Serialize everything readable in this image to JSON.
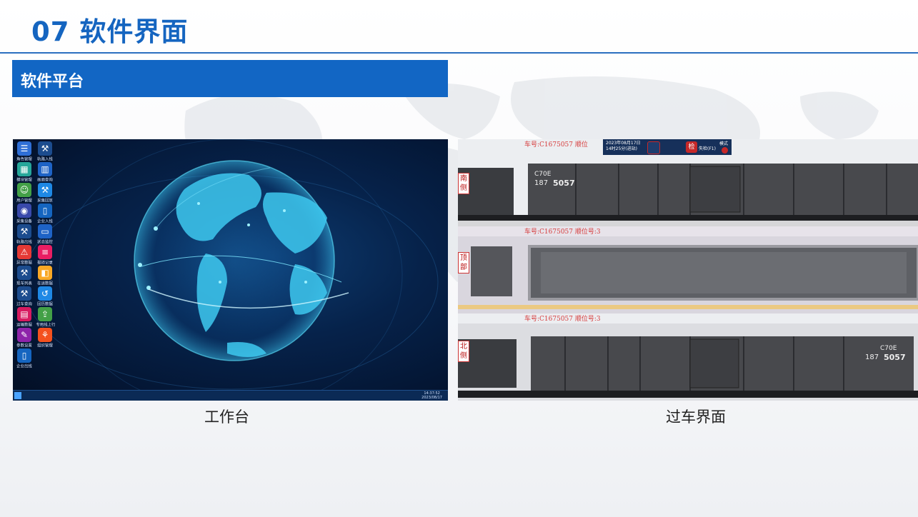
{
  "slide": {
    "title": "07 软件界面",
    "section_heading": "软件平台"
  },
  "workbench": {
    "caption": "工作台",
    "apps": [
      {
        "label": "角色管理",
        "icon": "list-icon",
        "color": "#2f6fd6"
      },
      {
        "label": "轨路入线",
        "icon": "train-icon",
        "color": "#1c4c8e"
      },
      {
        "label": "模块管理",
        "icon": "modules-icon",
        "color": "#26a69a"
      },
      {
        "label": "画面查询",
        "icon": "bar-chart-icon",
        "color": "#1e63c6"
      },
      {
        "label": "用户管理",
        "icon": "user-icon",
        "color": "#43a047"
      },
      {
        "label": "采集回放",
        "icon": "train-icon",
        "color": "#1e88e5"
      },
      {
        "label": "采集设备",
        "icon": "camera-icon",
        "color": "#3949ab"
      },
      {
        "label": "企业入线",
        "icon": "door-icon",
        "color": "#1565c0"
      },
      {
        "label": "轨路出线",
        "icon": "train-icon",
        "color": "#1c4c8e"
      },
      {
        "label": "状态监控",
        "icon": "monitor-icon",
        "color": "#1e63c6"
      },
      {
        "label": "异常数据",
        "icon": "warning-icon",
        "color": "#e53935"
      },
      {
        "label": "报损记录",
        "icon": "record-icon",
        "color": "#e91e63"
      },
      {
        "label": "现车列表",
        "icon": "train-icon",
        "color": "#1c4c8e"
      },
      {
        "label": "在途数据",
        "icon": "data-icon",
        "color": "#f9a825"
      },
      {
        "label": "过车查询",
        "icon": "train-icon",
        "color": "#1c4c8e"
      },
      {
        "label": "回历数据",
        "icon": "history-icon",
        "color": "#1e88e5"
      },
      {
        "label": "运输数据",
        "icon": "calendar-icon",
        "color": "#d81b60"
      },
      {
        "label": "专用线上行",
        "icon": "upload-icon",
        "color": "#43a047"
      },
      {
        "label": "参数设置",
        "icon": "edit-icon",
        "color": "#8e24aa"
      },
      {
        "label": "组织管理",
        "icon": "org-icon",
        "color": "#f4511e"
      },
      {
        "label": "企业出线",
        "icon": "door-icon",
        "color": "#1565c0"
      }
    ],
    "clock_time": "14:37:52",
    "clock_date": "2023/08/17"
  },
  "passing": {
    "caption": "过车界面",
    "hud_time_line1": "2023年08月17日",
    "hud_time_line2": "14时25分(进站)",
    "hud_action": "失检(F1)",
    "hud_mode": "模式",
    "hud_badge": "检",
    "lanes": [
      {
        "label_top": "南",
        "label_bottom": "侧",
        "caption": "车号:C1675057    顺位"
      },
      {
        "label_top": "顶",
        "label_bottom": "部",
        "caption": "车号:C1675057    顺位号:3"
      },
      {
        "label_top": "北",
        "label_bottom": "侧",
        "caption": "车号:C1675057    顺位号:3"
      }
    ],
    "car_code": "C70E",
    "car_num_a": "187",
    "car_num_b": "5057"
  }
}
